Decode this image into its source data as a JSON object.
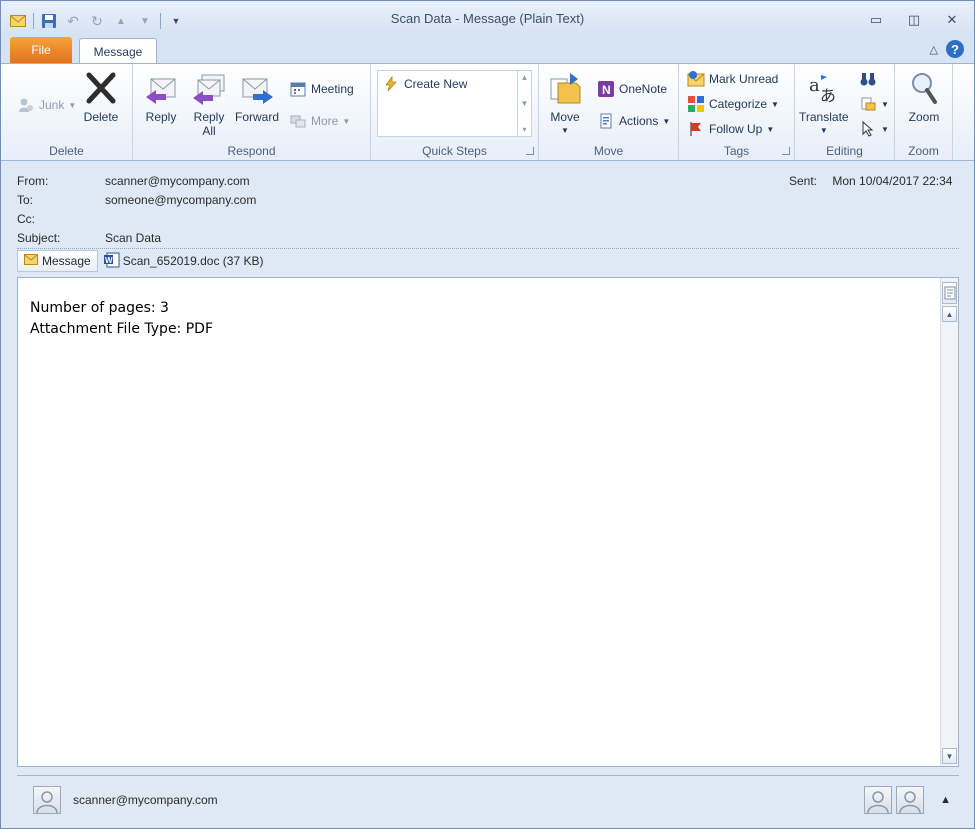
{
  "window": {
    "title": "Scan Data  -  Message (Plain Text)"
  },
  "tabs": {
    "file": "File",
    "message": "Message"
  },
  "ribbon": {
    "delete_group": {
      "label": "Delete",
      "junk": "Junk",
      "delete": "Delete"
    },
    "respond_group": {
      "label": "Respond",
      "reply": "Reply",
      "reply_all_line1": "Reply",
      "reply_all_line2": "All",
      "forward": "Forward",
      "meeting": "Meeting",
      "more": "More"
    },
    "quick_steps_group": {
      "label": "Quick Steps",
      "create_new": "Create New"
    },
    "move_group": {
      "label": "Move",
      "move": "Move",
      "onenote": "OneNote",
      "actions": "Actions"
    },
    "tags_group": {
      "label": "Tags",
      "mark_unread": "Mark Unread",
      "categorize": "Categorize",
      "follow_up": "Follow Up"
    },
    "editing_group": {
      "label": "Editing",
      "translate": "Translate"
    },
    "zoom_group": {
      "label": "Zoom",
      "zoom": "Zoom"
    }
  },
  "header": {
    "from_label": "From:",
    "from": "scanner@mycompany.com",
    "to_label": "To:",
    "to": "someone@mycompany.com",
    "cc_label": "Cc:",
    "cc": "",
    "subject_label": "Subject:",
    "subject": "Scan Data",
    "sent_label": "Sent:",
    "sent": "Mon 10/04/2017 22:34"
  },
  "attachments": {
    "message_tab": "Message",
    "file": "Scan_652019.doc (37 KB)"
  },
  "body": {
    "line1": "Number of pages: 3",
    "line2": "Attachment File Type: PDF"
  },
  "people_pane": {
    "contact": "scanner@mycompany.com"
  },
  "colors": {
    "file_tab": "#e4721c",
    "ribbon_bg": "#e7eef8",
    "frame": "#dfe9f5"
  }
}
